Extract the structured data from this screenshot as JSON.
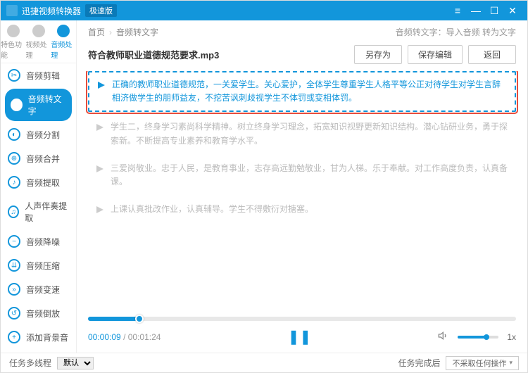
{
  "titlebar": {
    "app_name": "迅捷视频转换器",
    "edition": "极速版"
  },
  "topnav": [
    {
      "label": "特色功能"
    },
    {
      "label": "视频处理"
    },
    {
      "label": "音频处理"
    }
  ],
  "sidebar": {
    "items": [
      {
        "label": "音频剪辑"
      },
      {
        "label": "音频转文字"
      },
      {
        "label": "音频分割"
      },
      {
        "label": "音频合并"
      },
      {
        "label": "音频提取"
      },
      {
        "label": "人声伴奏提取"
      },
      {
        "label": "音频降噪"
      },
      {
        "label": "音频压缩"
      },
      {
        "label": "音频变速"
      },
      {
        "label": "音频倒放"
      },
      {
        "label": "添加背景音"
      }
    ]
  },
  "breadcrumb": {
    "root": "首页",
    "current": "音频转文字",
    "hint": "音频转文字：导入音频 转为文字"
  },
  "file": {
    "name": "符合教师职业道德规范要求.mp3"
  },
  "buttons": {
    "save_as": "另存为",
    "save_edit": "保存编辑",
    "back": "返回"
  },
  "segments": [
    {
      "text": "正确的教师职业道德规范，一关爱学生。关心爱护，全体学生尊重学生人格平等公正对待学生对学生言辞相济做学生的朋师益友，不挖苦讽刺歧视学生不体罚或变相体罚。",
      "active": true
    },
    {
      "text": "学生二，终身学习素尚科学精神。树立终身学习理念，拓宽知识视野更新知识结构。潜心钻研业务，勇于探索新。不断提高专业素养和教育学水平。",
      "active": false
    },
    {
      "text": "三爱岗敬业。忠于人民，是教育事业，志存高远勤勉敬业，甘为人梯。乐于奉献。对工作高度负责，认真备课。",
      "active": false
    },
    {
      "text": "上课认真批改作业，认真辅导。学生不得敷衍对搪塞。",
      "active": false
    }
  ],
  "player": {
    "current": "00:00:09",
    "duration": "00:01:24",
    "speed": "1x"
  },
  "bottom": {
    "multithread_label": "任务多线程",
    "multithread_value": "默认",
    "after_label": "任务完成后",
    "after_value": "不采取任何操作"
  }
}
